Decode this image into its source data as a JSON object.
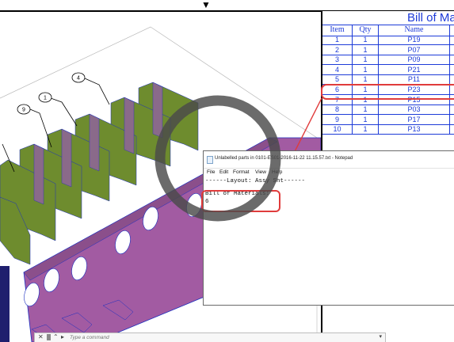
{
  "bom": {
    "title": "Bill of Mat",
    "headers": {
      "item": "Item",
      "qty": "Qty",
      "name": "Name"
    },
    "rows": [
      {
        "item": "1",
        "qty": "1",
        "name": "P19"
      },
      {
        "item": "2",
        "qty": "1",
        "name": "P07"
      },
      {
        "item": "3",
        "qty": "1",
        "name": "P09"
      },
      {
        "item": "4",
        "qty": "1",
        "name": "P21"
      },
      {
        "item": "5",
        "qty": "1",
        "name": "P11"
      },
      {
        "item": "6",
        "qty": "1",
        "name": "P23"
      },
      {
        "item": "7",
        "qty": "1",
        "name": "P15"
      },
      {
        "item": "8",
        "qty": "1",
        "name": "P03"
      },
      {
        "item": "9",
        "qty": "1",
        "name": "P17"
      },
      {
        "item": "10",
        "qty": "1",
        "name": "P13"
      }
    ],
    "highlight_color": "#e03c3c",
    "text_color": "#1d3bd8"
  },
  "balloons": [
    "4",
    "1",
    "9"
  ],
  "notepad": {
    "title": "Unlabelled parts in 0101-ES01-2016-11-22 11.15.57.txt - Notepad",
    "menu": [
      "File",
      "Edit",
      "Format",
      "View",
      "Help"
    ],
    "line1": "------Layout: Assy Sht------",
    "line2": "Bill of Materials:",
    "line3": "6"
  },
  "command": {
    "placeholder": "Type a command"
  },
  "colors": {
    "plate_green": "#6e8c2e",
    "web_purple": "#a25ba2",
    "edge_blue": "#1c2fc0"
  }
}
